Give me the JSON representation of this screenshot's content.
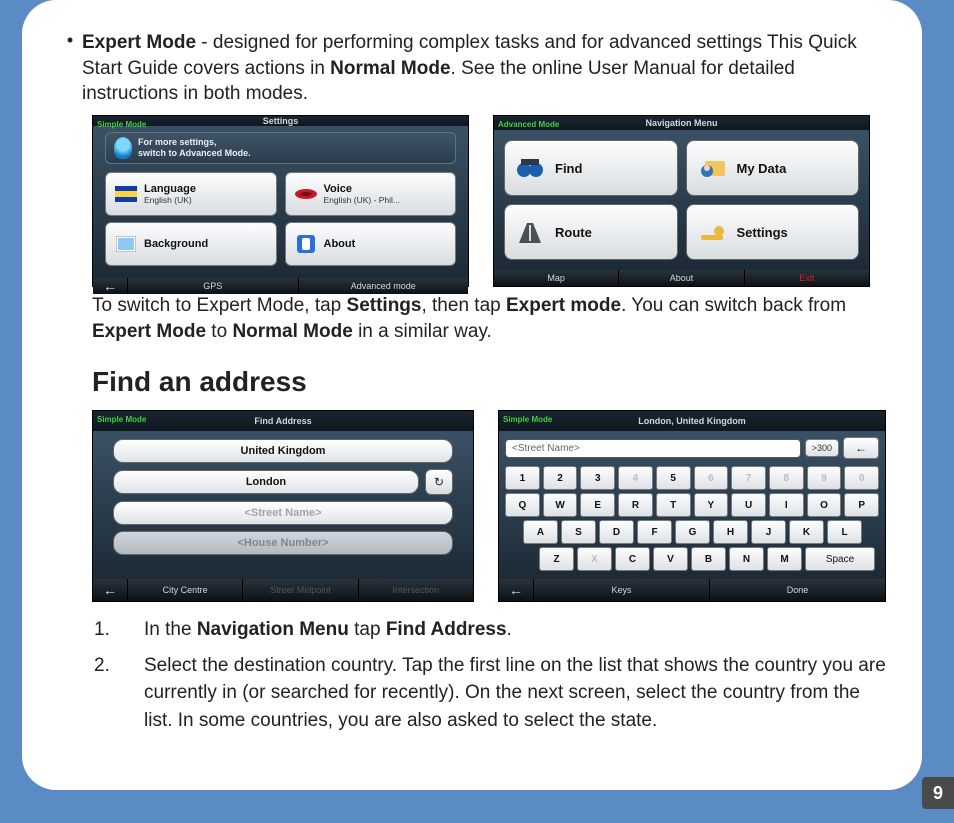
{
  "bullet": {
    "marker": "•",
    "expert_mode_label": "Expert Mode",
    "text_after_label": " - designed for performing complex tasks and for advanced settings This Quick Start Guide covers actions in ",
    "normal_mode_label": "Normal Mode",
    "text_tail": ". See the online User Manual for detailed instructions in both modes."
  },
  "sim_settings": {
    "mode": "Simple Mode",
    "title": "Settings",
    "hint_line1": "For more settings,",
    "hint_line2": "switch to Advanced Mode.",
    "language": {
      "label": "Language",
      "sub": "English (UK)"
    },
    "voice": {
      "label": "Voice",
      "sub": "English (UK) - Phil..."
    },
    "background": {
      "label": "Background"
    },
    "about": {
      "label": "About"
    },
    "footer": {
      "gps": "GPS",
      "advanced": "Advanced mode"
    }
  },
  "sim_nav": {
    "mode": "Advanced Mode",
    "title": "Navigation Menu",
    "find": "Find",
    "mydata": "My Data",
    "route": "Route",
    "settings": "Settings",
    "footer": {
      "map": "Map",
      "about": "About",
      "exit": "Exit"
    }
  },
  "para1": {
    "t1": "To switch to Expert Mode, tap ",
    "b1": "Settings",
    "t2": ", then tap ",
    "b2": "Expert mode",
    "t3": ". You can switch back from ",
    "b3": "Expert Mode",
    "t4": " to ",
    "b4": "Normal Mode",
    "t5": " in a similar way."
  },
  "heading_find": "Find an address",
  "sim_addr": {
    "mode": "Simple Mode",
    "title": "Find Address",
    "country": "United Kingdom",
    "city": "London",
    "street": "<Street Name>",
    "house": "<House Number>",
    "footer": {
      "citycentre": "City Centre",
      "midpoint": "Street Midpoint",
      "intersect": "Intersection"
    }
  },
  "sim_kb": {
    "mode": "Simple Mode",
    "title": "London, United Kingdom",
    "search": "<Street Name>",
    "count": ">300",
    "rows": [
      [
        {
          "k": "1"
        },
        {
          "k": "2"
        },
        {
          "k": "3"
        },
        {
          "k": "4",
          "d": true
        },
        {
          "k": "5"
        },
        {
          "k": "6",
          "d": true
        },
        {
          "k": "7",
          "d": true
        },
        {
          "k": "8",
          "d": true
        },
        {
          "k": "9",
          "d": true
        },
        {
          "k": "0",
          "d": true
        }
      ],
      [
        {
          "k": "Q"
        },
        {
          "k": "W"
        },
        {
          "k": "E"
        },
        {
          "k": "R"
        },
        {
          "k": "T"
        },
        {
          "k": "Y"
        },
        {
          "k": "U"
        },
        {
          "k": "I"
        },
        {
          "k": "O"
        },
        {
          "k": "P"
        }
      ],
      [
        {
          "k": "A"
        },
        {
          "k": "S"
        },
        {
          "k": "D"
        },
        {
          "k": "F"
        },
        {
          "k": "G"
        },
        {
          "k": "H"
        },
        {
          "k": "J"
        },
        {
          "k": "K"
        },
        {
          "k": "L"
        }
      ],
      [
        {
          "k": "Z"
        },
        {
          "k": "X",
          "d": true
        },
        {
          "k": "C"
        },
        {
          "k": "V"
        },
        {
          "k": "B"
        },
        {
          "k": "N"
        },
        {
          "k": "M"
        },
        {
          "k": "Space",
          "w": 2
        }
      ]
    ],
    "footer": {
      "keys": "Keys",
      "done": "Done"
    }
  },
  "steps": [
    {
      "num": "1.",
      "pre": "In the ",
      "b1": "Navigation Menu",
      "mid": " tap ",
      "b2": "Find Address",
      "tail": "."
    },
    {
      "num": "2.",
      "text": "Select the destination country. Tap the first line on the list that shows the country you are currently in (or searched for recently). On the next screen, select the country from the list. In some countries, you are also asked to select the state."
    }
  ],
  "page_number": "9"
}
